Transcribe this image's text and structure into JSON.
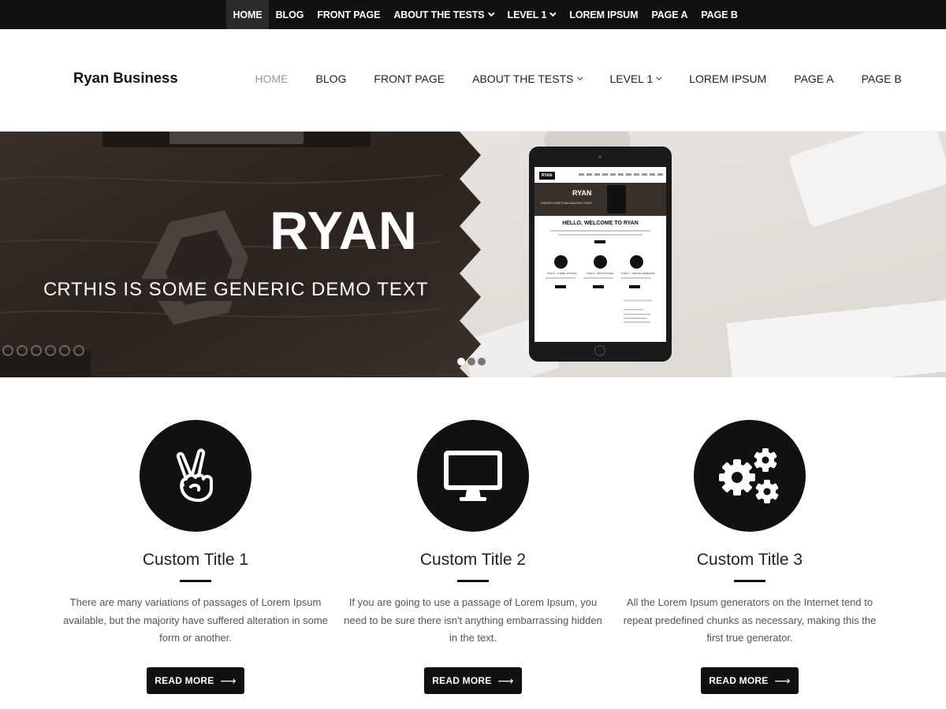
{
  "topbar": {
    "items": [
      {
        "label": "HOME",
        "active": true,
        "has_dropdown": false
      },
      {
        "label": "BLOG",
        "active": false,
        "has_dropdown": false
      },
      {
        "label": "FRONT PAGE",
        "active": false,
        "has_dropdown": false
      },
      {
        "label": "ABOUT THE TESTS",
        "active": false,
        "has_dropdown": true
      },
      {
        "label": "LEVEL 1",
        "active": false,
        "has_dropdown": true
      },
      {
        "label": "LOREM IPSUM",
        "active": false,
        "has_dropdown": false
      },
      {
        "label": "PAGE A",
        "active": false,
        "has_dropdown": false
      },
      {
        "label": "PAGE B",
        "active": false,
        "has_dropdown": false
      }
    ]
  },
  "header": {
    "site_title": "Ryan Business",
    "nav": [
      {
        "label": "HOME",
        "active": true,
        "has_dropdown": false
      },
      {
        "label": "BLOG",
        "active": false,
        "has_dropdown": false
      },
      {
        "label": "FRONT PAGE",
        "active": false,
        "has_dropdown": false
      },
      {
        "label": "ABOUT THE TESTS",
        "active": false,
        "has_dropdown": true
      },
      {
        "label": "LEVEL 1",
        "active": false,
        "has_dropdown": true
      },
      {
        "label": "LOREM IPSUM",
        "active": false,
        "has_dropdown": false
      },
      {
        "label": "PAGE A",
        "active": false,
        "has_dropdown": false
      },
      {
        "label": "PAGE B",
        "active": false,
        "has_dropdown": false
      }
    ]
  },
  "hero": {
    "title": "RYAN",
    "ghost_text": "CR",
    "subtitle": "THIS IS SOME GENERIC DEMO TEXT",
    "slide_count": 3,
    "active_slide": 1,
    "tablet": {
      "logo": "RYAN",
      "hero_title": "RYAN",
      "hero_subtitle": "CREATE SOMETHING AMAZING TODAY",
      "heading": "HELLO, WELCOME TO RYAN",
      "steps": [
        "STEP 1 : THEME OPTIONS",
        "STEP 2 : SETUP SLIDER",
        "STEP 3 : CREATE HOMEPAGE"
      ]
    }
  },
  "features": [
    {
      "icon": "peace-hand-icon",
      "title": "Custom Title 1",
      "text": "There are many variations of passages of Lorem Ipsum available, but the majority have suffered alteration in some form or another.",
      "button": "READ MORE"
    },
    {
      "icon": "monitor-icon",
      "title": "Custom Title 2",
      "text": "If you are going to use a passage of Lorem Ipsum, you need to be sure there isn't anything embarrassing hidden in the text.",
      "button": "READ MORE"
    },
    {
      "icon": "gears-icon",
      "title": "Custom Title 3",
      "text": "All the Lorem Ipsum generators on the Internet tend to repeat predefined chunks as necessary, making this the first true generator.",
      "button": "READ MORE"
    }
  ],
  "colors": {
    "topbar_bg": "#111111",
    "accent": "#111111",
    "nav_active": "#999999"
  }
}
